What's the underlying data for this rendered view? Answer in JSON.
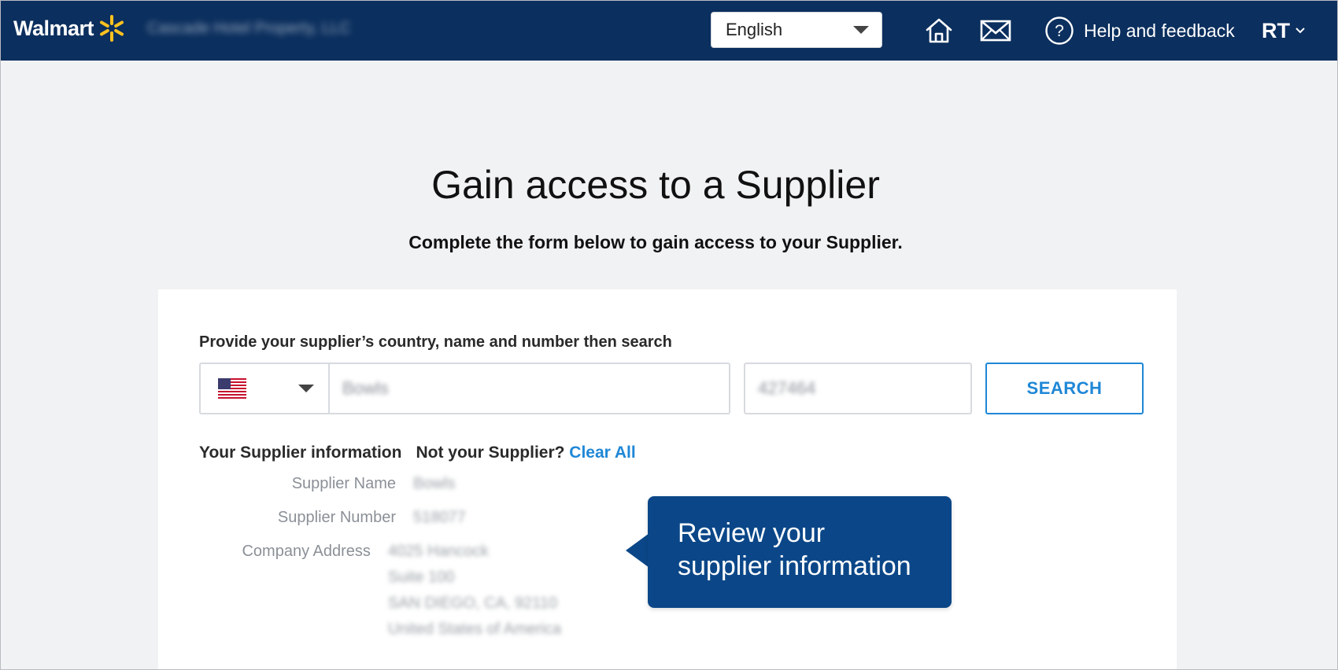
{
  "header": {
    "logo_text": "Walmart",
    "company_name": "Cascade Hotel Property, LLC",
    "language": {
      "selected": "English"
    },
    "help_label": "Help and feedback",
    "user_initials": "RT",
    "colors": {
      "bar": "#0b2f5e",
      "spark": "#ffc220"
    }
  },
  "page": {
    "title": "Gain access to a Supplier",
    "subtitle": "Complete the form below to gain access to your Supplier."
  },
  "form": {
    "instruction": "Provide your supplier’s country, name and number then search",
    "country_flag": "us-flag-icon",
    "supplier_name_value": "Bowls",
    "supplier_number_value": "427464",
    "search_label": "SEARCH",
    "accent_color": "#1f87d6"
  },
  "info": {
    "heading": "Your Supplier information",
    "not_yours": "Not your Supplier?",
    "clear_all": "Clear All",
    "rows": [
      {
        "label": "Supplier Name",
        "value": "Bowls"
      },
      {
        "label": "Supplier Number",
        "value": "518077"
      },
      {
        "label": "Company Address",
        "value": "4025 Hancock"
      }
    ],
    "address_extra": [
      "Suite 100",
      "SAN DIEGO, CA, 92110",
      "United States of America"
    ]
  },
  "callout": {
    "line1": "Review your",
    "line2": "supplier information",
    "color": "#0b4788"
  }
}
